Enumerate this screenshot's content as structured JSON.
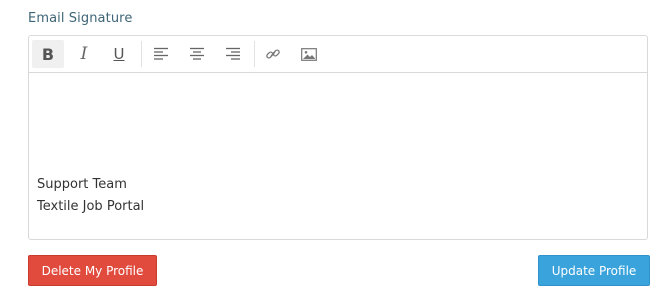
{
  "form": {
    "label": "Email Signature"
  },
  "toolbar": {
    "buttons": [
      {
        "name": "bold",
        "icon": "bold-icon",
        "active": true
      },
      {
        "name": "italic",
        "icon": "italic-icon",
        "active": false
      },
      {
        "name": "underline",
        "icon": "underline-icon",
        "active": false
      },
      {
        "name": "align-left",
        "icon": "align-left-icon",
        "active": false
      },
      {
        "name": "align-center",
        "icon": "align-center-icon",
        "active": false
      },
      {
        "name": "align-right",
        "icon": "align-right-icon",
        "active": false
      },
      {
        "name": "link",
        "icon": "link-icon",
        "active": false
      },
      {
        "name": "image",
        "icon": "image-icon",
        "active": false
      }
    ]
  },
  "editor": {
    "lines": [
      "Support Team",
      "Textile Job Portal"
    ]
  },
  "actions": {
    "delete_label": "Delete My Profile",
    "update_label": "Update Profile"
  },
  "colors": {
    "label": "#3e6577",
    "delete": "#e04b3e",
    "update": "#3aa3dc"
  }
}
